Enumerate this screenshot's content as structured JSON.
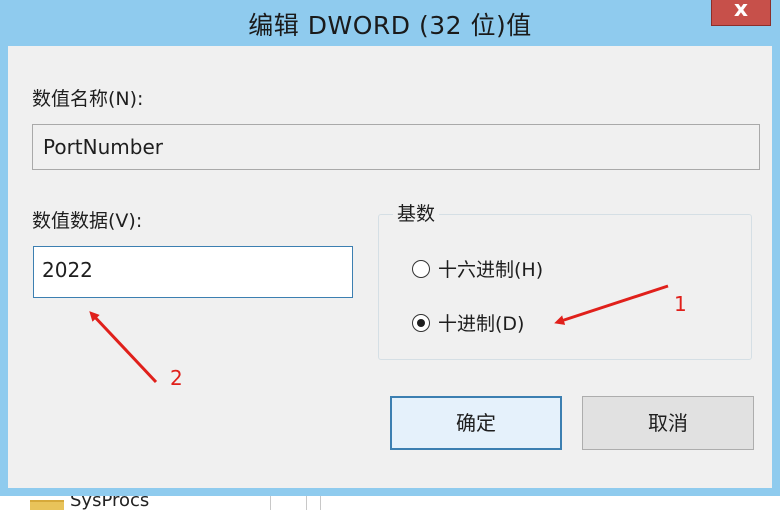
{
  "dialog": {
    "title": "编辑 DWORD (32 位)值",
    "close_glyph": "x"
  },
  "value_name": {
    "label": "数值名称(N):",
    "value": "PortNumber"
  },
  "value_data": {
    "label": "数值数据(V):",
    "value": "2022"
  },
  "base": {
    "title": "基数",
    "options": [
      {
        "label": "十六进制(H)",
        "selected": false
      },
      {
        "label": "十进制(D)",
        "selected": true
      }
    ]
  },
  "buttons": {
    "ok": "确定",
    "cancel": "取消"
  },
  "annotations": {
    "arrow1_label": "1",
    "arrow2_label": "2",
    "color": "#e0201b"
  },
  "background": {
    "partial_text": "SysProcs"
  }
}
